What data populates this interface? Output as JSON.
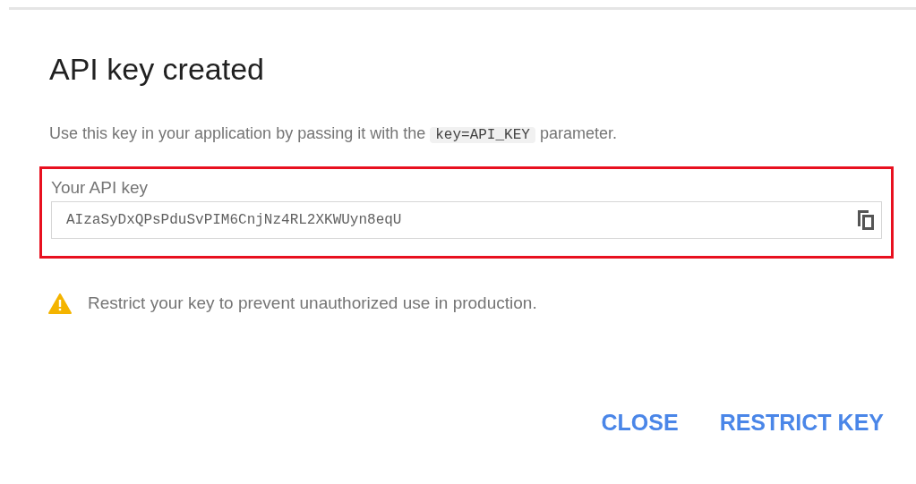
{
  "dialog": {
    "title": "API key created",
    "instruction": {
      "before": "Use this key in your application by passing it with the",
      "code": "key=API_KEY",
      "after": "parameter."
    },
    "key_field": {
      "label": "Your API key",
      "value": "AIzaSyDxQPsPduSvPIM6CnjNz4RL2XKWUyn8eqU"
    },
    "warning": "Restrict your key to prevent unauthorized use in production.",
    "buttons": [
      "CLOSE",
      "RESTRICT KEY"
    ]
  }
}
